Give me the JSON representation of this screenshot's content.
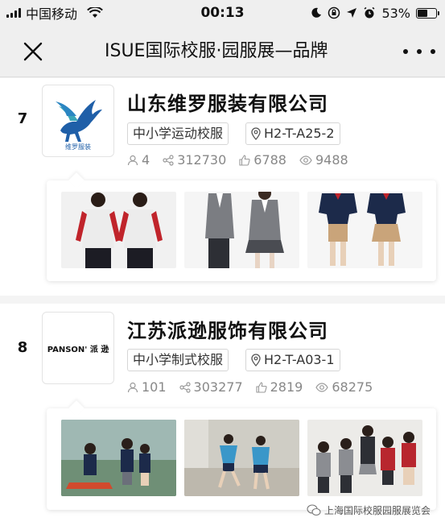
{
  "status_bar": {
    "carrier": "中国移动",
    "time": "00:13",
    "battery_percent": "53%",
    "battery_level": 0.53
  },
  "nav": {
    "title": "ISUE国际校服·园服展—品牌"
  },
  "entries": [
    {
      "rank": "7",
      "company": "山东维罗服装有限公司",
      "logo_text": "维罗服装",
      "category": "中小学运动校服",
      "booth": "H2-T-A25-2",
      "stats": {
        "people": "4",
        "shares": "312730",
        "likes": "6788",
        "views": "9488"
      }
    },
    {
      "rank": "8",
      "company": "江苏派逊服饰有限公司",
      "logo_text": "PANSON' 派 逊",
      "category": "中小学制式校服",
      "booth": "H2-T-A03-1",
      "stats": {
        "people": "101",
        "shares": "303277",
        "likes": "2819",
        "views": "68275"
      }
    }
  ],
  "watermark": "上海国际校服园服展览会",
  "colors": {
    "accent_logo_blue": "#1f5fa8",
    "logo_teal": "#3aa6b9",
    "uniform_navy": "#1c2a4a",
    "uniform_red": "#c0242b"
  },
  "icons": [
    "wifi-icon",
    "moon-icon",
    "lock-rotation-icon",
    "location-arrow-icon",
    "alarm-icon",
    "close-icon",
    "more-icon",
    "person-icon",
    "share-icon",
    "thumbs-up-icon",
    "eye-icon",
    "location-pin-icon",
    "wechat-icon"
  ]
}
